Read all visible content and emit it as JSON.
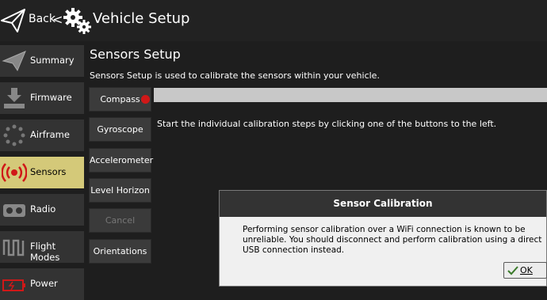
{
  "header": {
    "back_label": "Back",
    "separator": "<",
    "title": "Vehicle Setup"
  },
  "sidebar": {
    "items": [
      {
        "label": "Summary",
        "icon": "paper-plane-icon",
        "active": false
      },
      {
        "label": "Firmware",
        "icon": "download-icon",
        "active": false
      },
      {
        "label": "Airframe",
        "icon": "airframe-icon",
        "active": false
      },
      {
        "label": "Sensors",
        "icon": "sensors-icon",
        "active": true
      },
      {
        "label": "Radio",
        "icon": "radio-icon",
        "active": false
      },
      {
        "label": "Flight Modes",
        "icon": "flight-modes-icon",
        "active": false
      },
      {
        "label": "Power",
        "icon": "battery-icon",
        "active": false
      }
    ]
  },
  "main": {
    "title": "Sensors Setup",
    "description": "Sensors Setup is used to calibrate the sensors within your vehicle.",
    "status": "Start the individual calibration steps by clicking one of the buttons to the left.",
    "buttons": [
      {
        "label": "Compass",
        "enabled": true
      },
      {
        "label": "Gyroscope",
        "enabled": true
      },
      {
        "label": "Accelerometer",
        "enabled": true
      },
      {
        "label": "Level Horizon",
        "enabled": true
      },
      {
        "label": "Cancel",
        "enabled": false
      },
      {
        "label": "Orientations",
        "enabled": true
      }
    ],
    "progress": 0
  },
  "dialog": {
    "title": "Sensor Calibration",
    "message": "Performing sensor calibration over a WiFi connection is known to be unreliable. You should disconnect and perform calibration using a direct USB connection instead.",
    "ok_label": "OK"
  },
  "colors": {
    "background": "#1e1e1e",
    "sidebar_item": "#333333",
    "active_item": "#d4c979",
    "alert_red": "#d01818",
    "progress": "#c8c8c8"
  }
}
